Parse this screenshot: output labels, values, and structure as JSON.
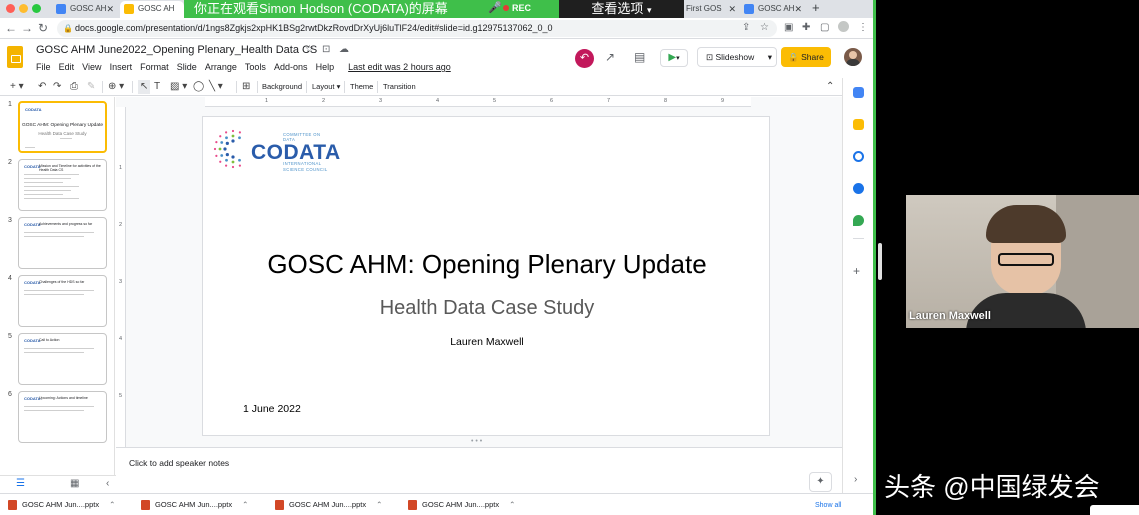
{
  "browser": {
    "tabs": [
      {
        "label": "GOSC AH",
        "active": false
      },
      {
        "label": "GOSC AH",
        "active": true
      },
      {
        "label": "GOSC AH",
        "active": false
      },
      {
        "label": "First GOS",
        "active": false
      },
      {
        "label": "GOSC AH",
        "active": false
      }
    ],
    "new_tab": "+",
    "url": "docs.google.com/presentation/d/1ngs8Zgkjs2xpHK1BSg2rwtDkzRovdDrXyUj6luTlF24/edit#slide=id.g12975137062_0_0"
  },
  "zoom": {
    "sharing_banner": "你正在观看Simon Hodson (CODATA)的屏幕",
    "rec_label": "REC",
    "view_options": "查看选项"
  },
  "doc": {
    "title": "GOSC AHM June2022_Opening Plenary_Health Data CS",
    "menus": [
      "File",
      "Edit",
      "View",
      "Insert",
      "Format",
      "Slide",
      "Arrange",
      "Tools",
      "Add-ons",
      "Help"
    ],
    "last_edit": "Last edit was 2 hours ago",
    "slideshow_label": "Slideshow",
    "share_label": "Share"
  },
  "toolbar": {
    "background": "Background",
    "layout": "Layout",
    "theme": "Theme",
    "transition": "Transition"
  },
  "ruler": {
    "h_ticks": [
      "1",
      "2",
      "3",
      "4",
      "5",
      "6",
      "7",
      "8",
      "9"
    ],
    "v_ticks": [
      "1",
      "2",
      "3",
      "4",
      "5"
    ]
  },
  "filmstrip": {
    "slides": [
      {
        "num": "1",
        "logo": "CODATA",
        "title": "GOSC AHM: Opening Plenary Update",
        "sub": "Health Data Case Study",
        "selected": true
      },
      {
        "num": "2",
        "logo": "CODATA",
        "title": "Mission and Timeline for activities of the Health Data CS",
        "sub": "",
        "selected": false
      },
      {
        "num": "3",
        "logo": "CODATA",
        "title": "Achievements and progress so far",
        "sub": "",
        "selected": false
      },
      {
        "num": "4",
        "logo": "CODATA",
        "title": "Challenges of the HDS so far",
        "sub": "",
        "selected": false
      },
      {
        "num": "5",
        "logo": "CODATA",
        "title": "Call to Action",
        "sub": "",
        "selected": false
      },
      {
        "num": "6",
        "logo": "CODATA",
        "title": "Upcoming: Actions and timeline",
        "sub": "",
        "selected": false
      }
    ]
  },
  "slide": {
    "logo_main": "CODATA",
    "logo_line1": "COMMITTEE ON DATA",
    "logo_line2": "INTERNATIONAL",
    "logo_line3": "SCIENCE COUNCIL",
    "title": "GOSC AHM: Opening Plenary Update",
    "subtitle": "Health Data Case Study",
    "author": "Lauren Maxwell",
    "date": "1 June 2022"
  },
  "notes": {
    "placeholder": "Click to add speaker notes"
  },
  "downloads": {
    "items": [
      "GOSC AHM Jun....pptx",
      "GOSC AHM Jun....pptx",
      "GOSC AHM Jun....pptx",
      "GOSC AHM Jun....pptx"
    ],
    "show_all": "Show all"
  },
  "video": {
    "participant_name": "Lauren Maxwell"
  },
  "watermark": {
    "text": "头条 @中国绿发会"
  },
  "colors": {
    "zoom_green": "#3fbf4a",
    "slides_yellow": "#fbbc04",
    "codata_blue": "#2a5caa",
    "history_pink": "#c2185b"
  }
}
